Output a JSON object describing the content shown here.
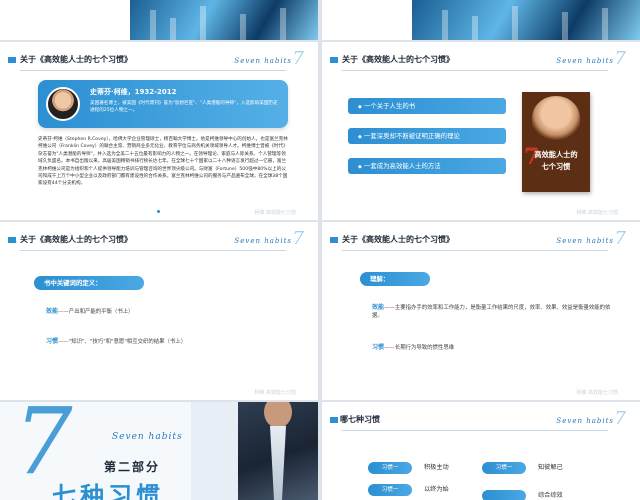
{
  "slides": {
    "common": {
      "title": "关于《高效能人士的七个习惯》",
      "seven_text": "Seven habits",
      "seven_digit": "7",
      "watermark": "柯维 高效能七习惯"
    },
    "s1": {
      "bio_name": "史蒂芬·柯维，1932-2012",
      "bio_desc": "美国著名博士，被美国《时代周刊》誉为\"思想巨匠\"、\"人类潜能的导师\"，入选影响美国历史进程的25位人物之一。",
      "paragraph": "史蒂芬·柯维（Stephen R.Covey），哈佛大学企业管理硕士，杨百翰大学博士。他是柯维领导中心的创始人，也是富兰克林柯维公司（Franklin Covey）的联合主席、营销商业多元化业、教育学位与商务机关领域领导人才。柯维博士曾被《时代》杂志誉为\"人类潜能的导师\"，并入选为全美二十五位最有影响力的人物之一。在领导理论、家庭与人际关系、个人管理等领域久负盛名。本书自出版以来，高居美国畅销书排行榜长达七年，在全球七十个国家以二十八种语言发行超过一亿册，富兰克林柯维公司是为组织和个人提供领导能力培训与管理咨询的世界顶尖级公司。与财富（Fortune）500强中80%以上的公司和成千上万个中小型企业以及政府部门都有建设性的合作关系。富兰克林柯维公司的服务与产品遍布全球，在全球38个国家设有44个分支机构。"
    },
    "s2": {
      "bullets": [
        "一个关于人生的书",
        "一套深奥却不断被证明正确的理论",
        "一套成为高效能人士的方法"
      ],
      "book_title_1": "高效能人士的",
      "book_title_2": "七个习惯",
      "book_digit": "7"
    },
    "s3": {
      "pill": "书中关键词的定义：",
      "kw1_term": "效能",
      "kw1_dash": "——",
      "kw1_def": "产出和产能的平衡（书上）",
      "kw2_term": "习惯",
      "kw2_dash": "——",
      "kw2_def": "\"知识\"、\"技巧\"和\"意愿\"相互交织的结果（书上）"
    },
    "s4": {
      "pill": "理解：",
      "kw1_term": "效能",
      "kw1_dash": "——",
      "kw1_def": "主要指办手的效率和工作能力，是衡量工作结果的尺度，效率、效果、效益是衡量效能的依据。",
      "kw2_term": "习惯",
      "kw2_dash": "——",
      "kw2_def": "长期行为导致的惯性思维"
    },
    "s5": {
      "digit": "7",
      "seven_text": "Seven habits",
      "part": "第二部分",
      "big": "七种习惯"
    },
    "s6": {
      "title": "哪七种习惯",
      "items": [
        {
          "btn": "习惯一",
          "label": "积极主动"
        },
        {
          "btn": "习惯一",
          "label": "知彼解己"
        },
        {
          "btn": "习惯一",
          "label": "以终为始"
        },
        {
          "btn": "",
          "label": "综合综效"
        }
      ]
    }
  }
}
